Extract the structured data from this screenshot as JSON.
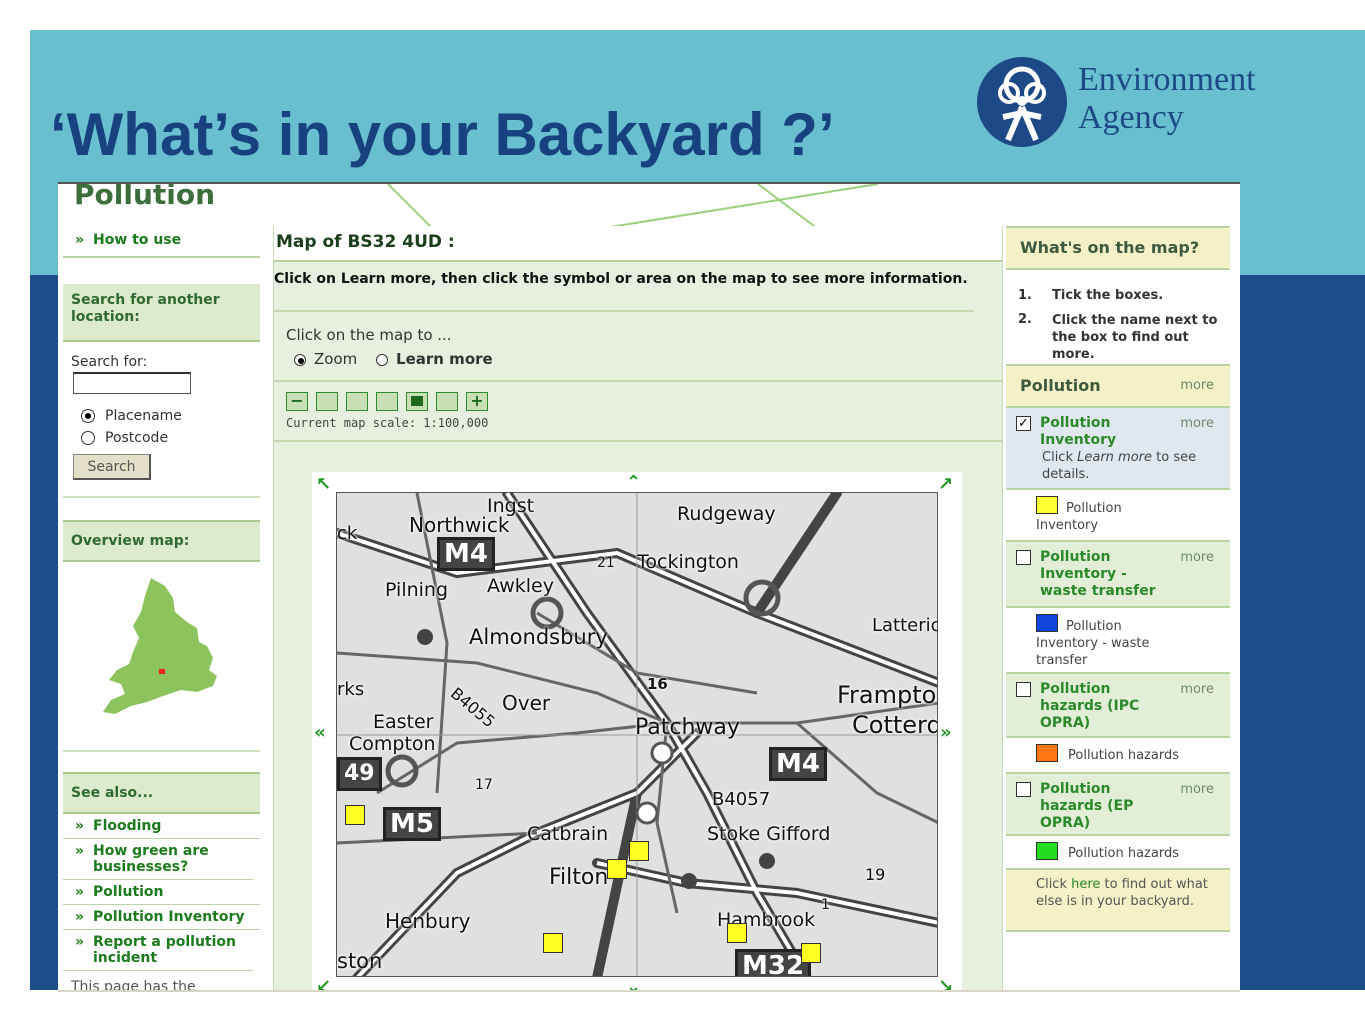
{
  "slide": {
    "title": "‘What’s in your Backyard ?’",
    "logo_line1": "Environment",
    "logo_line2": "Agency"
  },
  "page": {
    "heading": "Pollution"
  },
  "left": {
    "how_to_use": "How to use",
    "search_heading": "Search for another location:",
    "search_label": "Search for:",
    "search_value": "",
    "radio_placename": "Placename",
    "radio_postcode": "Postcode",
    "search_button": "Search",
    "overview_heading": "Overview map:",
    "see_also_heading": "See also...",
    "links": [
      "Flooding",
      "How green are businesses?",
      "Pollution",
      "Pollution Inventory",
      "Report a pollution incident"
    ],
    "theme_text": "This page has the following theme:"
  },
  "center": {
    "map_title": "Map of BS32 4UD :",
    "instructions": "Click on Learn more, then click the symbol or area on the map to see more information.",
    "click_prompt": "Click on the map to ...",
    "mode_zoom": "Zoom",
    "mode_learn": "Learn more",
    "zoom_minus": "−",
    "zoom_plus": "+",
    "scale": "Current map scale: 1:100,000"
  },
  "map": {
    "labels": [
      "Ingst",
      "Rudgeway",
      "Northwick",
      "M4",
      "Tockington",
      "Pilning",
      "Awkley",
      "Almondsbury",
      "Latteric",
      "Frampto",
      "Cotterd",
      "Over",
      "B4055",
      "Easter",
      "Compton",
      "Patchway",
      "M4",
      "16",
      "B4057",
      "M5",
      "Catbrain",
      "Stoke Gifford",
      "Filton",
      "Hambrook",
      "Henbury",
      "M32",
      "ston",
      "19",
      "21",
      "49",
      "17",
      "1",
      "rks",
      "ck"
    ]
  },
  "right": {
    "heading": "What's on the map?",
    "step1": "Tick the boxes.",
    "step2": "Click the name next to the box to find out more.",
    "section": "Pollution",
    "more": "more",
    "layers": [
      {
        "name": "Pollution Inventory",
        "checked": true,
        "note_prefix": "Click ",
        "note_em": "Learn more",
        "note_suffix": " to see details.",
        "swatch_label": "Pollution Inventory",
        "color": "#ffff33"
      },
      {
        "name": "Pollution Inventory - waste transfer",
        "checked": false,
        "swatch_label": "Pollution Inventory - waste transfer",
        "color": "#1144dd"
      },
      {
        "name": "Pollution hazards (IPC OPRA)",
        "checked": false,
        "swatch_label": "Pollution hazards",
        "color": "#ff7711"
      },
      {
        "name": "Pollution hazards (EP OPRA)",
        "checked": false,
        "swatch_label": "Pollution hazards",
        "color": "#22dd22"
      }
    ],
    "footer_prefix": "Click ",
    "footer_link": "here",
    "footer_suffix": " to find out what else is in your backyard."
  },
  "colors": {
    "title_blue": "#17427f",
    "band_teal": "#69bfcf",
    "band_navy": "#1d4e8c",
    "link_green": "#1b7a1b"
  }
}
